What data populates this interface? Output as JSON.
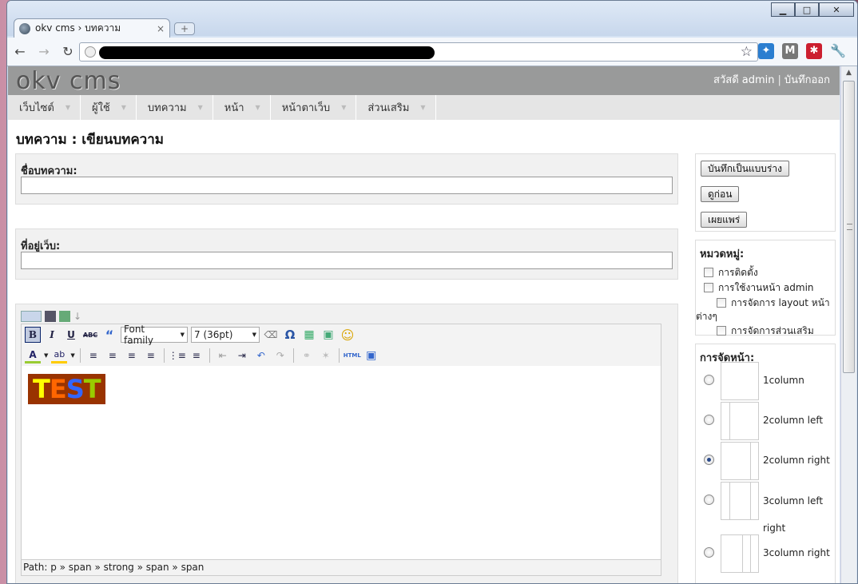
{
  "browser": {
    "tab_title": "okv cms › บทความ",
    "tab_close": "×",
    "new_tab": "+",
    "win_min": "▁",
    "win_max": "□",
    "win_close": "✕",
    "bookmark_icon": "star-icon",
    "wrench_icon": "wrench-icon"
  },
  "site": {
    "logo": "okv cms",
    "greeting": "สวัสดี admin",
    "separator": "|",
    "logout": "บันทึกออก"
  },
  "menu": [
    {
      "label": "เว็บไซต์"
    },
    {
      "label": "ผู้ใช้"
    },
    {
      "label": "บทความ"
    },
    {
      "label": "หน้า"
    },
    {
      "label": "หน้าตาเว็บ"
    },
    {
      "label": "ส่วนเสริม"
    }
  ],
  "page": {
    "title": "บทความ : เขียนบทความ",
    "title_label": "ชื่อบทความ:",
    "title_value": "",
    "url_label": "ที่อยู่เว็บ:",
    "url_value": ""
  },
  "editor": {
    "font_family": "Font family",
    "font_size": "7 (36pt)",
    "content_text": [
      "T",
      "E",
      "S",
      "T"
    ],
    "content_colors": [
      "#ffff00",
      "#ff6600",
      "#3366ff",
      "#99cc00"
    ],
    "content_bg": "#993300",
    "path": "Path: p » span » strong » span » span",
    "bold": "B",
    "italic": "I",
    "underline": "U",
    "strike": "ABC",
    "html": "HTML"
  },
  "actions": {
    "save_draft": "บันทึกเป็นแบบร่าง",
    "preview": "ดูก่อน",
    "publish": "เผยแพร่"
  },
  "categories": {
    "heading": "หมวดหมู่:",
    "items": [
      {
        "label": "การติดตั้ง",
        "level": 0,
        "checked": false
      },
      {
        "label": "การใช้งานหน้า admin",
        "level": 0,
        "checked": false
      },
      {
        "label": "การจัดการ layout หน้าต่างๆ",
        "level": 1,
        "checked": false
      },
      {
        "label": "การจัดการส่วนเสริม",
        "level": 1,
        "checked": false
      }
    ]
  },
  "layout": {
    "heading": "การจัดหน้า:",
    "options": [
      {
        "label": "1column",
        "selected": false
      },
      {
        "label": "2column left",
        "selected": false
      },
      {
        "label": "2column right",
        "selected": true
      },
      {
        "label": "3column left right",
        "selected": false
      },
      {
        "label": "3column right",
        "selected": false
      }
    ]
  }
}
